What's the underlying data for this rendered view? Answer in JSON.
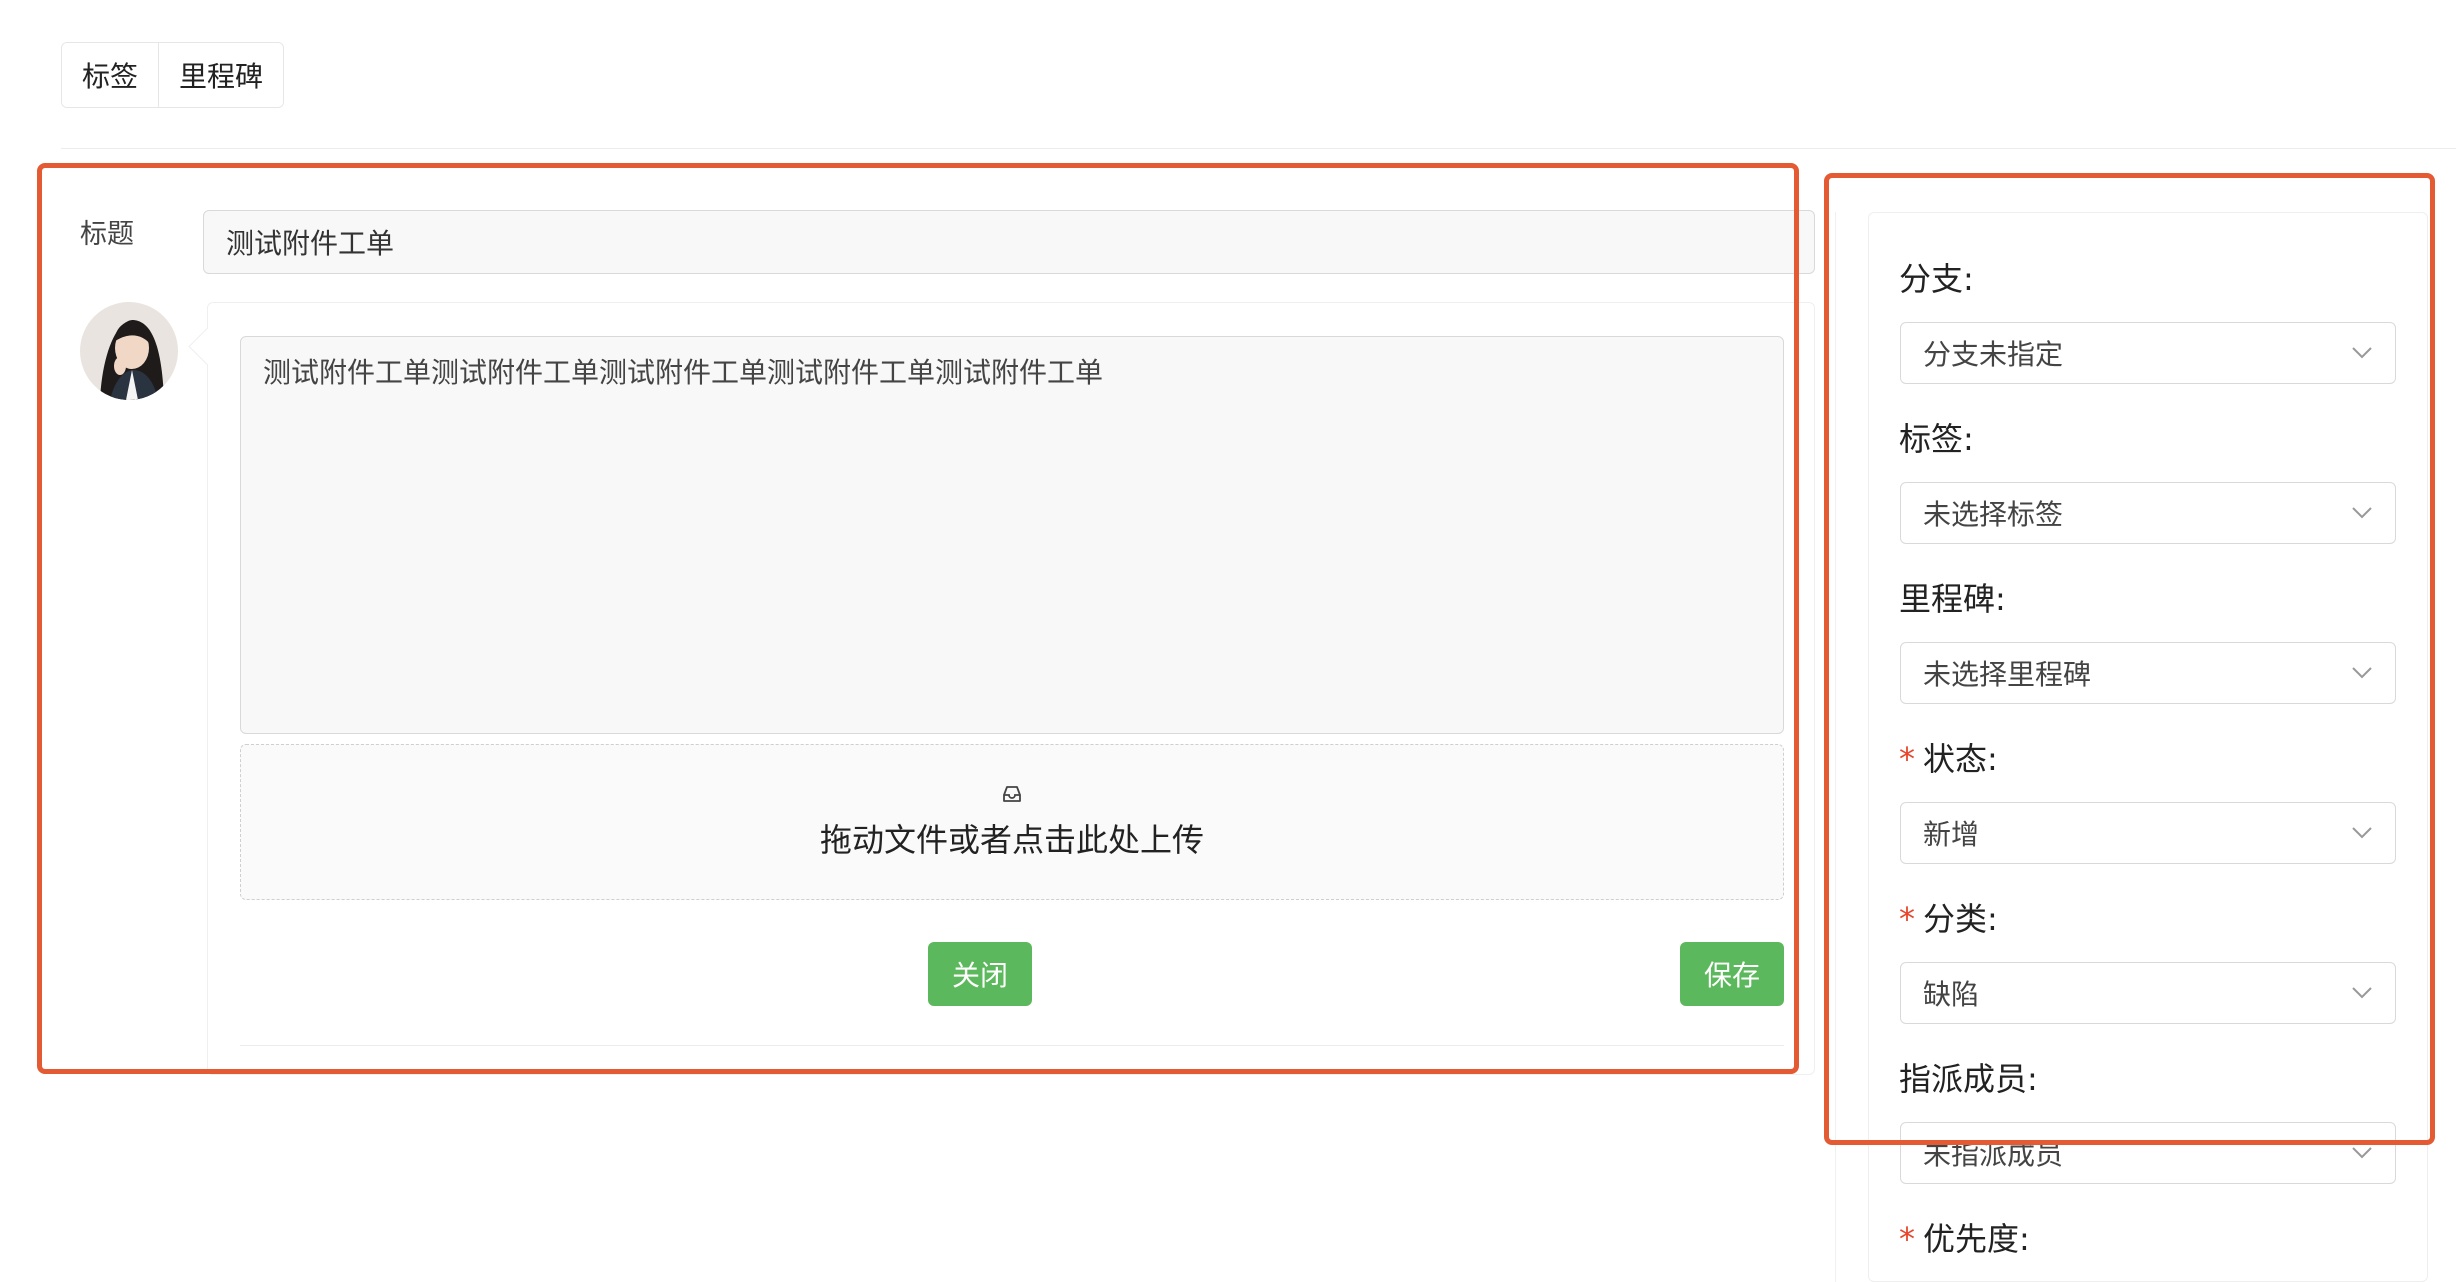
{
  "tabs": [
    {
      "label": "标签"
    },
    {
      "label": "里程碑"
    }
  ],
  "issue": {
    "title_label": "标题",
    "title_value": "测试附件工单",
    "description": "测试附件工单测试附件工单测试附件工单测试附件工单测试附件工单",
    "upload_text": "拖动文件或者点击此处上传",
    "close_label": "关闭",
    "save_label": "保存"
  },
  "sidebar": {
    "fields": [
      {
        "label": "分支:",
        "value": "分支未指定",
        "required": false
      },
      {
        "label": "标签:",
        "value": "未选择标签",
        "required": false
      },
      {
        "label": "里程碑:",
        "value": "未选择里程碑",
        "required": false
      },
      {
        "label": "状态:",
        "value": "新增",
        "required": true
      },
      {
        "label": "分类:",
        "value": "缺陷",
        "required": true
      },
      {
        "label": "指派成员:",
        "value": "未指派成员",
        "required": false
      },
      {
        "label": "优先度:",
        "value": "",
        "required": true
      }
    ],
    "required_mark": "*"
  },
  "colors": {
    "primary_button": "#5cb85c",
    "annotation": "#e35a33",
    "required": "#e8452c"
  }
}
